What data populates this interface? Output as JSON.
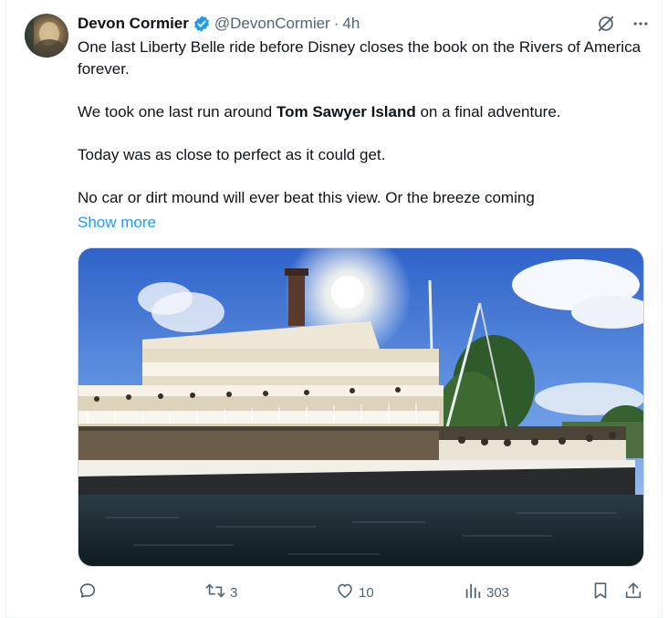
{
  "author": {
    "name": "Devon Cormier",
    "handle": "@DevonCormier",
    "separator": "·",
    "time": "4h"
  },
  "tweet": {
    "p1": "One last Liberty Belle ride before Disney closes the book on the Rivers of America forever.",
    "p2_before": "We took one last run around ",
    "p2_bold": "Tom Sawyer Island",
    "p2_after": " on a final adventure.",
    "p3": "Today was as close to perfect as it could get.",
    "p4": "No car or dirt mound will ever beat this view. Or the breeze coming",
    "show_more": "Show more"
  },
  "icons": {
    "verified": "verified-badge-icon",
    "grok": "grok-icon",
    "more": "more-icon",
    "reply": "reply-icon",
    "retweet": "retweet-icon",
    "like": "heart-icon",
    "views": "views-icon",
    "bookmark": "bookmark-icon",
    "share": "share-icon"
  },
  "metrics": {
    "reply_count": "",
    "retweets": "3",
    "likes": "10",
    "views": "303"
  },
  "colors": {
    "accent": "#1d9bf0",
    "secondary_text": "#536471",
    "primary_text": "#0f1419"
  }
}
